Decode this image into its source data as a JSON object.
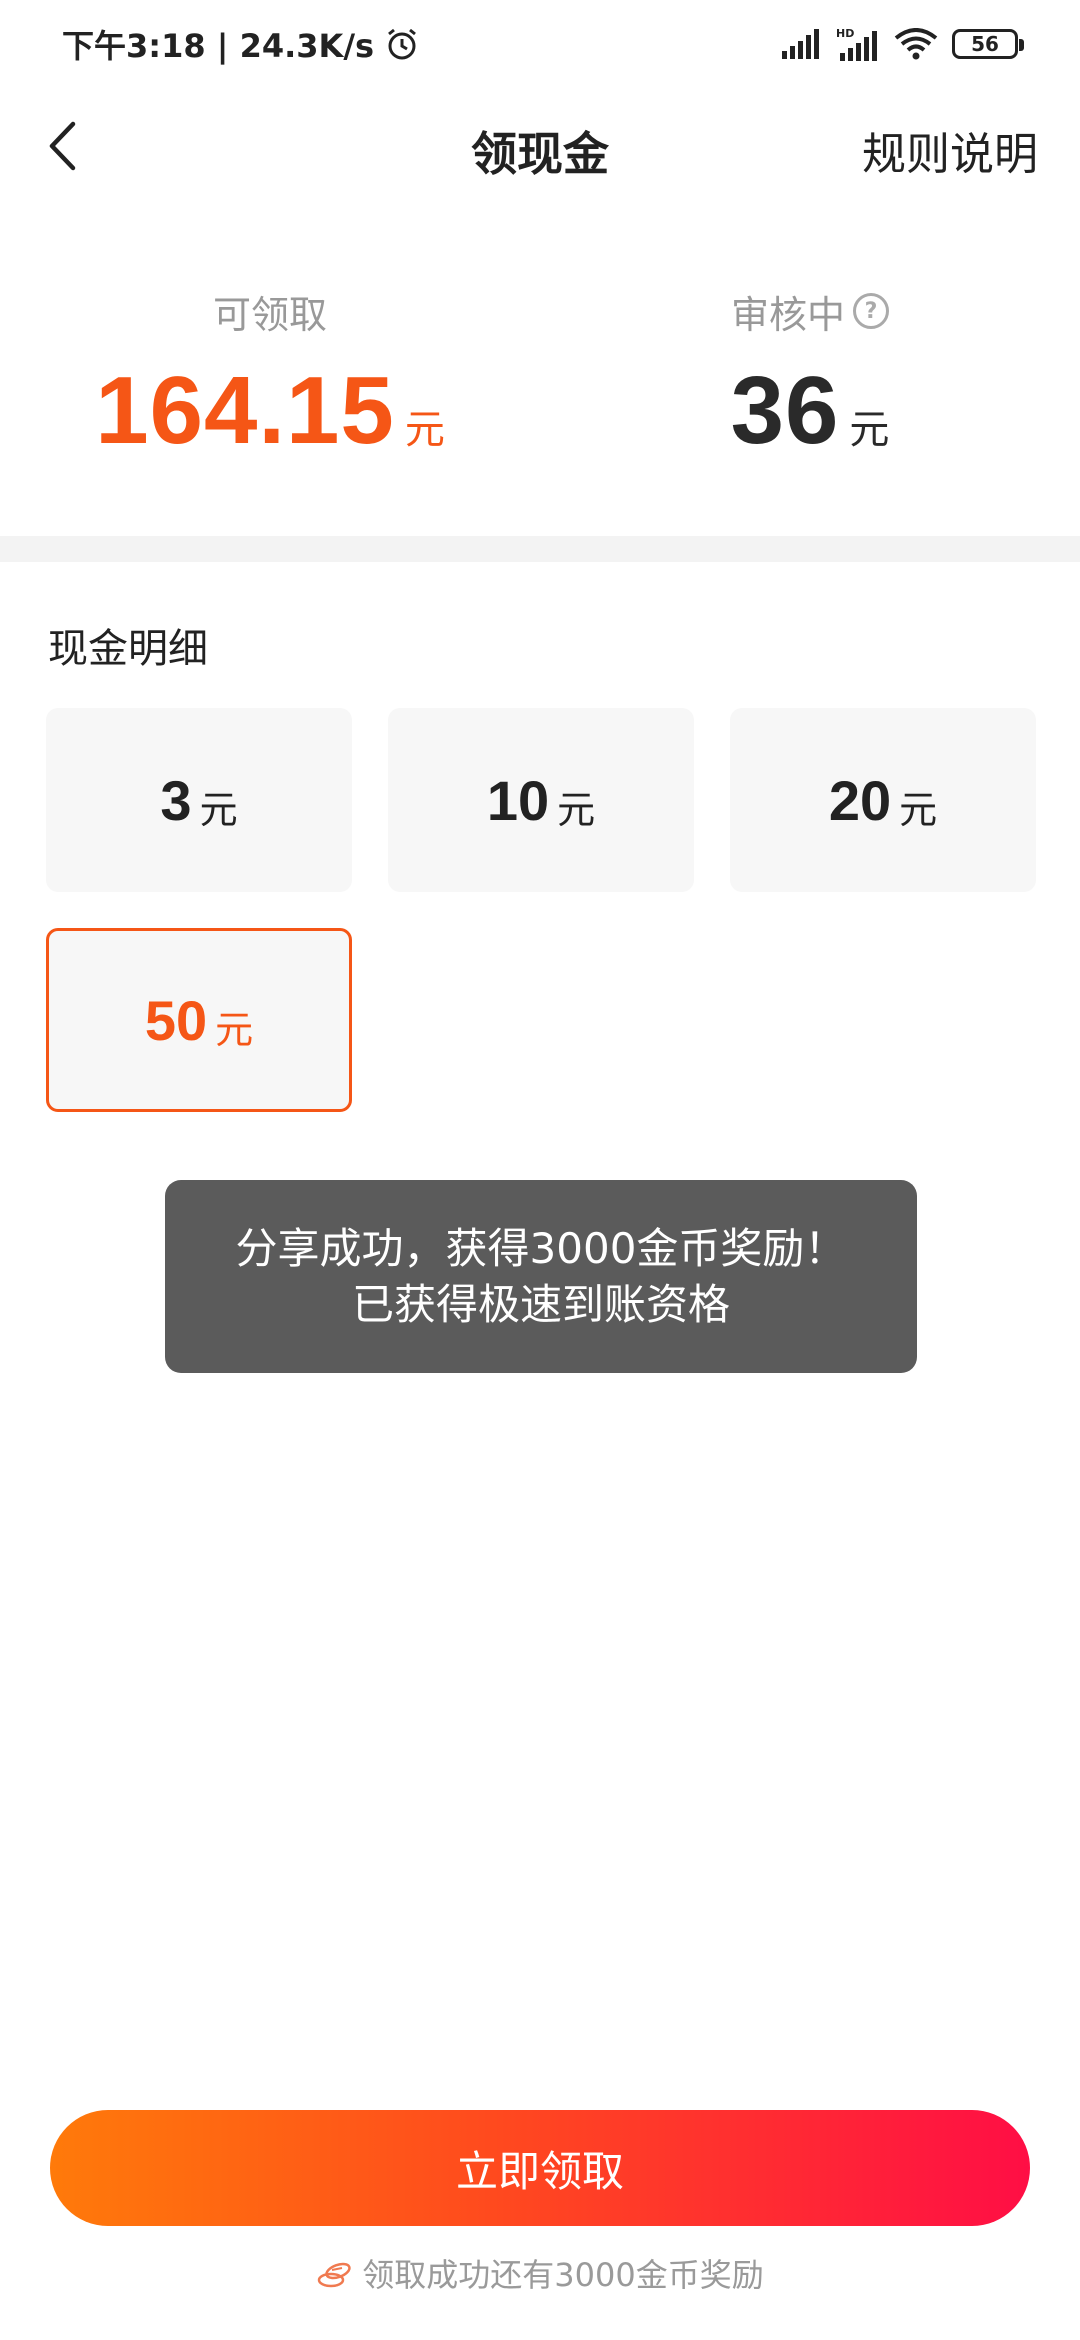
{
  "status_bar": {
    "time_speed": "下午3:18 | 24.3K/s",
    "battery": "56",
    "icons": [
      "alarm-icon",
      "signal-icon",
      "hd-signal-icon",
      "wifi-icon",
      "battery-icon"
    ]
  },
  "nav": {
    "title": "领现金",
    "rules": "规则说明",
    "back_icon": "chevron-left-icon"
  },
  "balance": {
    "available": {
      "label": "可领取",
      "amount": "164.15",
      "unit": "元"
    },
    "reviewing": {
      "label": "审核中",
      "amount": "36",
      "unit": "元",
      "help_icon": "?"
    }
  },
  "cash_details": {
    "title": "现金明细",
    "options": [
      {
        "value": "3",
        "unit": "元",
        "selected": false
      },
      {
        "value": "10",
        "unit": "元",
        "selected": false
      },
      {
        "value": "20",
        "unit": "元",
        "selected": false
      },
      {
        "value": "50",
        "unit": "元",
        "selected": true
      }
    ]
  },
  "toast": {
    "line1": "分享成功，获得3000金币奖励！",
    "line2": "已获得极速到账资格"
  },
  "claim": {
    "button": "立即领取",
    "note": "领取成功还有3000金币奖励"
  },
  "colors": {
    "accent": "#f55616",
    "gradient_start": "#ff7a0a",
    "gradient_end": "#ff0e45",
    "toast_bg": "#5b5b5b"
  }
}
